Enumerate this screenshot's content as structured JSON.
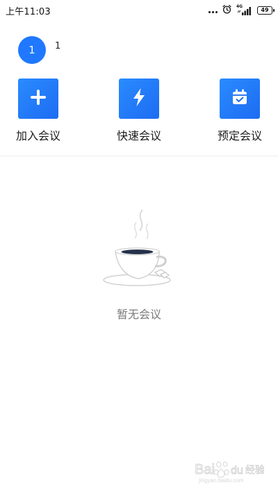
{
  "status_bar": {
    "time": "上午11:03",
    "network": "4G",
    "battery": "49",
    "icons": [
      "more-dots-icon",
      "alarm-icon",
      "signal-icon",
      "battery-icon"
    ]
  },
  "user": {
    "avatar_text": "1",
    "name": "1",
    "avatar_color": "#1f78ff"
  },
  "actions": [
    {
      "label": "加入会议",
      "icon": "plus-icon"
    },
    {
      "label": "快速会议",
      "icon": "lightning-icon"
    },
    {
      "label": "预定会议",
      "icon": "calendar-check-icon"
    }
  ],
  "empty_state": {
    "message": "暂无会议",
    "icon": "coffee-cup-icon"
  },
  "watermark": {
    "logo_text": "Baidu",
    "subtitle": "经验",
    "url": "jingyan.baidu.com"
  },
  "colors": {
    "accent": "#1f78ff",
    "accent_dark": "#1d6cf2",
    "text": "#1c1c1c",
    "muted": "#7a7a7a",
    "divider": "#ececec"
  }
}
